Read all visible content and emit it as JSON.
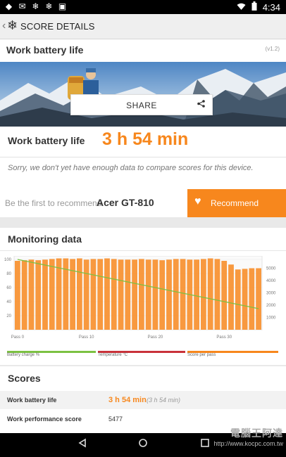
{
  "statusbar": {
    "time": "4:34",
    "icons": [
      "shield-icon",
      "mail-icon",
      "snowflake-icon",
      "snowflake-icon",
      "image-icon"
    ]
  },
  "appbar": {
    "title": "SCORE DETAILS"
  },
  "test": {
    "title": "Work battery life",
    "version": "(v1.2)"
  },
  "share": {
    "label": "SHARE"
  },
  "score": {
    "name": "Work battery life",
    "value": "3 h 54 min",
    "message": "Sorry, we don't yet have enough data to compare scores for this device."
  },
  "recommend": {
    "prefix": "Be the first to recommend",
    "device": "Acer GT-810",
    "button": "Recommend"
  },
  "monitoring": {
    "title": "Monitoring data",
    "legend": [
      "Battery charge %",
      "Temperature °C",
      "Score per pass"
    ],
    "colors": {
      "battery": "#7cc142",
      "temperature": "#c9323a",
      "score": "#f7871d"
    }
  },
  "chart_data": {
    "type": "bar",
    "x_tick_labels": [
      "Pass 0",
      "Pass 10",
      "Pass 20",
      "Pass 30"
    ],
    "y_left_ticks": [
      "100",
      "80",
      "60",
      "40",
      "20"
    ],
    "y_right_ticks": [
      "5000",
      "4000",
      "3000",
      "2000",
      "1000"
    ],
    "series": [
      {
        "name": "Score per pass",
        "axis": "right",
        "values": [
          5600,
          5650,
          5700,
          5650,
          5700,
          5750,
          5800,
          5800,
          5750,
          5800,
          5700,
          5750,
          5750,
          5800,
          5750,
          5700,
          5700,
          5700,
          5750,
          5700,
          5700,
          5650,
          5700,
          5750,
          5750,
          5700,
          5700,
          5750,
          5800,
          5750,
          5600,
          5300,
          4900,
          4950,
          5000,
          5000
        ]
      },
      {
        "name": "Battery charge %",
        "axis": "left",
        "values": [
          100,
          98,
          96,
          94,
          92,
          90,
          88,
          86,
          84,
          82,
          80,
          78,
          76,
          74,
          72,
          70,
          68,
          66,
          64,
          62,
          60,
          58,
          56,
          54,
          52,
          50,
          48,
          46,
          44,
          42,
          40,
          38,
          36,
          34,
          32,
          30
        ]
      }
    ],
    "ylim_left": [
      0,
      105
    ],
    "ylim_right": [
      0,
      6000
    ],
    "grid": true
  },
  "scores": {
    "title": "Scores",
    "rows": [
      {
        "label": "Work battery life",
        "value": "3 h 54 min",
        "secondary": "(3 h 54 min)"
      },
      {
        "label": "Work performance score",
        "value": "5477"
      }
    ]
  },
  "watermark": {
    "line1": "電腦王阿達",
    "line2": "http://www.kocpc.com.tw"
  }
}
